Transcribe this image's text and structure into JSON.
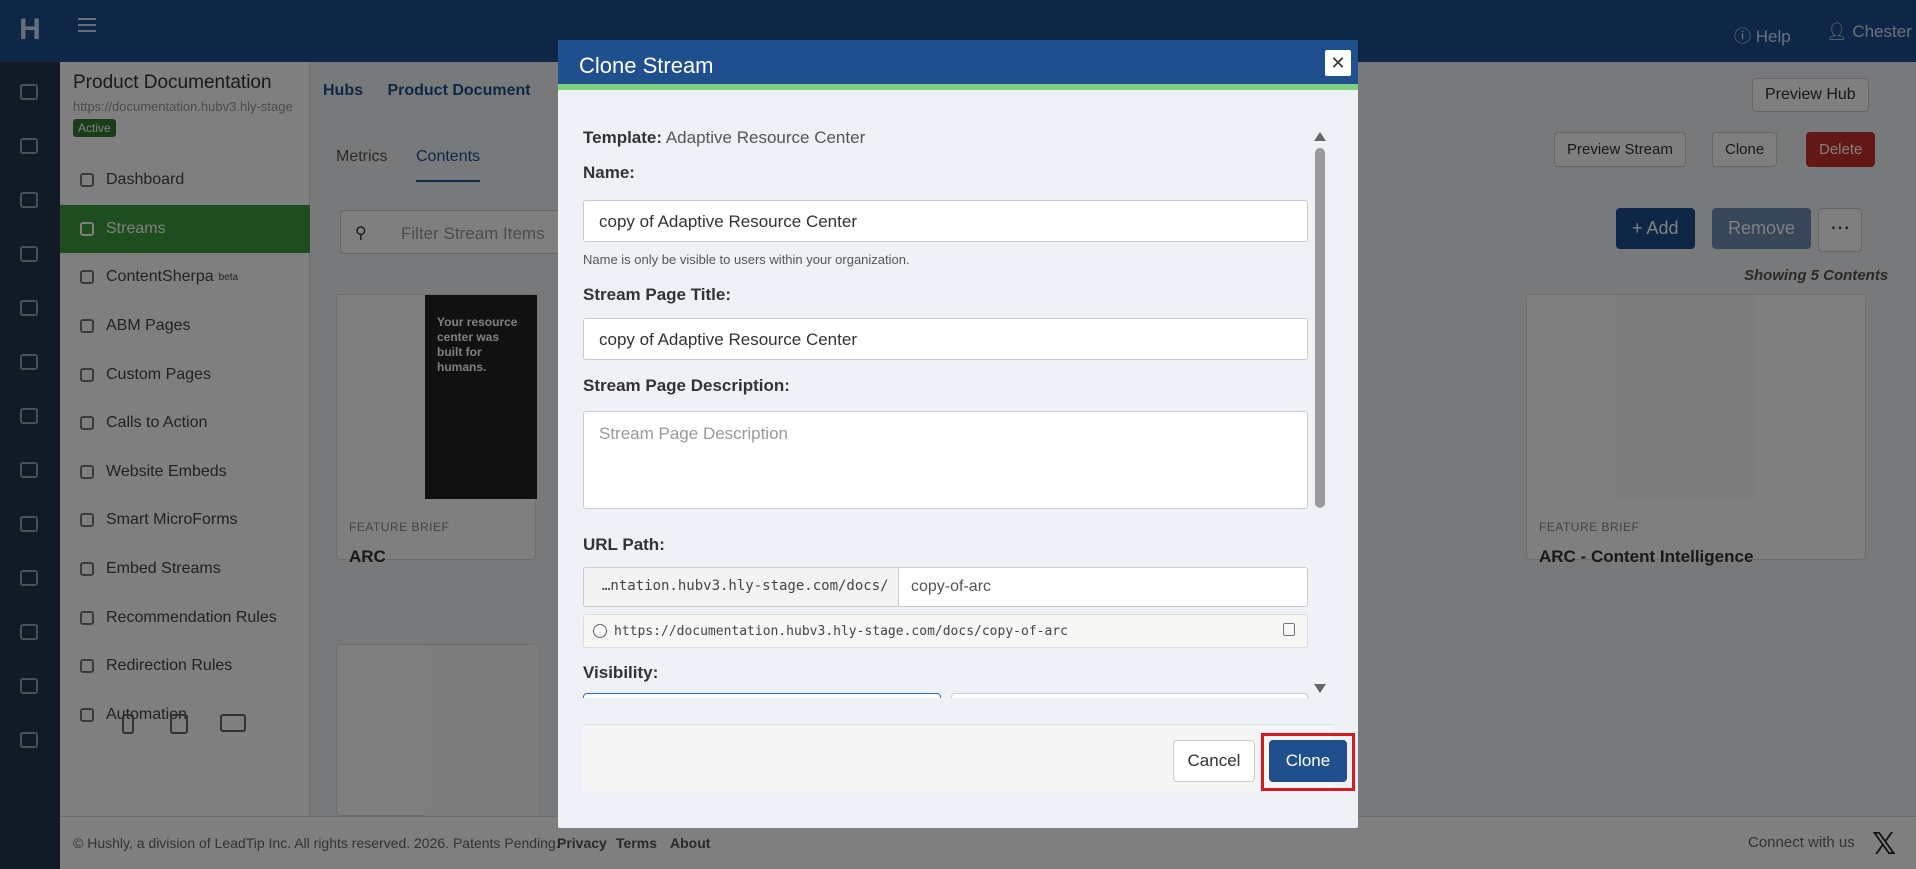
{
  "app": {
    "logo": "H",
    "help": "Help",
    "user": "Chester"
  },
  "sidebar": {
    "title": "Product Documentation",
    "url": "https://documentation.hubv3.hly-stage",
    "status": "Active",
    "items": [
      {
        "label": "Dashboard",
        "icon": "dashboard-icon"
      },
      {
        "label": "Streams",
        "icon": "list-icon"
      },
      {
        "label": "ContentSherpa",
        "icon": "compass-icon",
        "badge": "beta"
      },
      {
        "label": "ABM Pages",
        "icon": "page-icon"
      },
      {
        "label": "Custom Pages",
        "icon": "file-icon"
      },
      {
        "label": "Calls to Action",
        "icon": "bolt-icon"
      },
      {
        "label": "Website Embeds",
        "icon": "window-icon"
      },
      {
        "label": "Smart MicroForms",
        "icon": "form-icon"
      },
      {
        "label": "Embed Streams",
        "icon": "embed-icon"
      },
      {
        "label": "Recommendation Rules",
        "icon": "thumbs-up-icon"
      },
      {
        "label": "Redirection Rules",
        "icon": "sitemap-icon"
      },
      {
        "label": "Automation",
        "icon": "wand-icon"
      }
    ]
  },
  "main": {
    "breadcrumb_hubs": "Hubs",
    "breadcrumb_product": "Product Document",
    "preview_hub": "Preview Hub",
    "tabs": [
      "Metrics",
      "Contents"
    ],
    "actions": {
      "preview_stream": "Preview Stream",
      "clone": "Clone",
      "delete": "Delete"
    },
    "filter_placeholder": "Filter Stream Items",
    "add": "+ Add",
    "remove": "Remove",
    "showing": "Showing 5 Contents",
    "cards": [
      {
        "type": "FEATURE BRIEF",
        "title": "ARC",
        "thumb_text": "Your resource center was built for humans."
      },
      {
        "type": "FEATURE BRIEF",
        "title": "ARC - Content Intelligence"
      }
    ]
  },
  "footer": {
    "copyright": "© Hushly, a division of LeadTip Inc. All rights reserved. 2026. Patents Pending.",
    "privacy": "Privacy",
    "terms": "Terms",
    "about": "About",
    "connect": "Connect with us"
  },
  "modal": {
    "title": "Clone Stream",
    "template_label": "Template:",
    "template_value": "Adaptive Resource Center",
    "name_label": "Name:",
    "name_value": "copy of Adaptive Resource Center",
    "name_help": "Name is only be visible to users within your organization.",
    "page_title_label": "Stream Page Title:",
    "page_title_value": "copy of Adaptive Resource Center",
    "description_label": "Stream Page Description:",
    "description_placeholder": "Stream Page Description",
    "url_label": "URL Path:",
    "url_prefix": "…ntation.hubv3.hly-stage.com/docs/",
    "url_slug": "copy-of-arc",
    "url_full": "https://documentation.hubv3.hly-stage.com/docs/copy-of-arc",
    "visibility_label": "Visibility:",
    "cancel": "Cancel",
    "clone": "Clone"
  }
}
